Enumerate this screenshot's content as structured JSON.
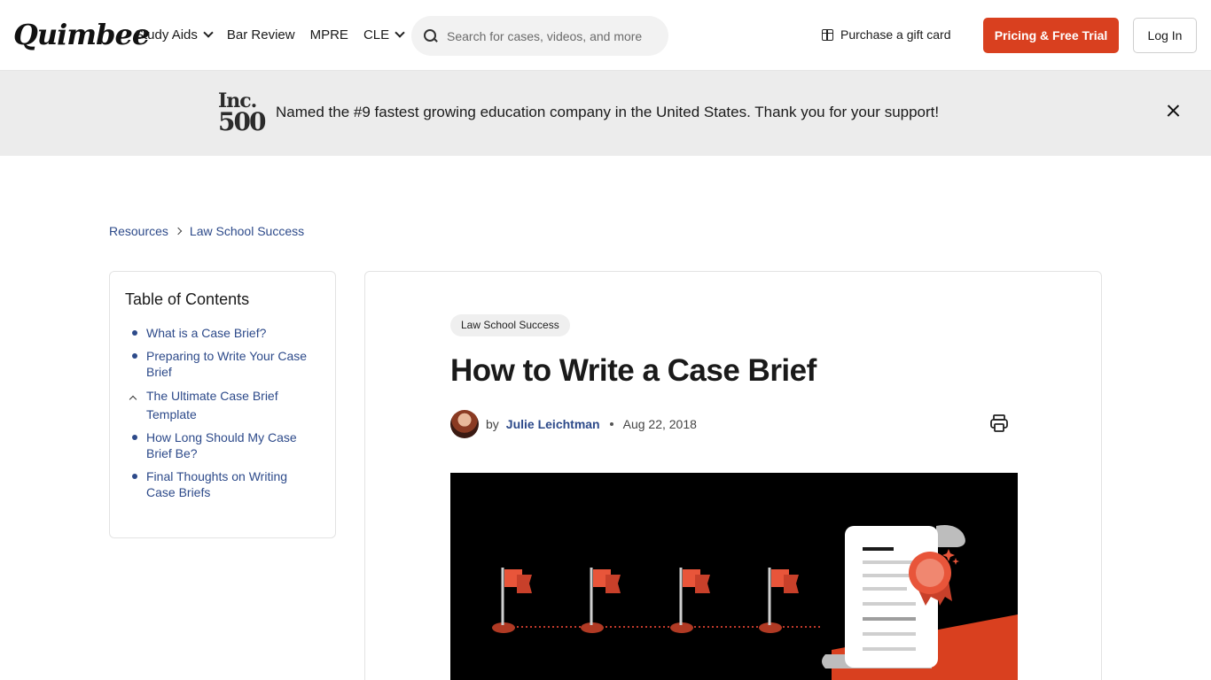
{
  "header": {
    "logo": "Quimbee",
    "nav": [
      {
        "label": "Study Aids",
        "dropdown": true
      },
      {
        "label": "Bar Review",
        "dropdown": false
      },
      {
        "label": "MPRE",
        "dropdown": false
      },
      {
        "label": "CLE",
        "dropdown": true
      }
    ],
    "search_placeholder": "Search for cases, videos, and more",
    "gift_label": "Purchase a gift card",
    "pricing_label": "Pricing & Free Trial",
    "login_label": "Log In"
  },
  "banner": {
    "logo_line1": "Inc.",
    "logo_line2": "500",
    "text": "Named the #9 fastest growing education company in the United States. Thank you for your support!"
  },
  "breadcrumb": [
    "Resources",
    "Law School Success"
  ],
  "toc": {
    "title": "Table of Contents",
    "items": [
      "What is a Case Brief?",
      "Preparing to Write Your Case Brief",
      "The Ultimate Case Brief Template",
      "How Long Should My Case Brief Be?",
      "Final Thoughts on Writing Case Briefs"
    ]
  },
  "article": {
    "tag": "Law School Success",
    "title": "How to Write a Case Brief",
    "by": "by",
    "author": "Julie Leichtman",
    "date": "Aug 22, 2018"
  },
  "colors": {
    "accent": "#d9401f",
    "link": "#2d4a8a",
    "banner_bg": "#ececec",
    "flag": "#e8553a"
  },
  "icons": [
    "search-icon",
    "chevron-down-icon",
    "gift-icon",
    "close-icon",
    "chevron-right-icon",
    "chevron-up-icon",
    "printer-icon"
  ]
}
